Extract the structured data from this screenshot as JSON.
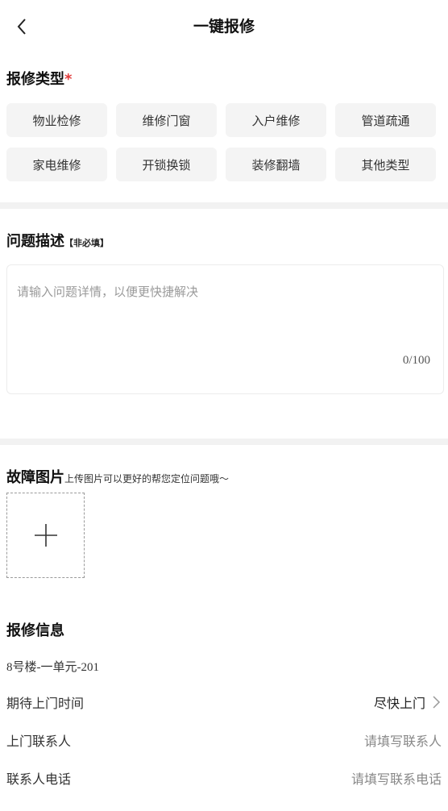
{
  "header": {
    "title": "一键报修",
    "back_icon": "chevron-left-icon"
  },
  "repair_type": {
    "title": "报修类型",
    "required_mark": "*",
    "options": [
      "物业检修",
      "维修门窗",
      "入户维修",
      "管道疏通",
      "家电维修",
      "开锁换锁",
      "装修翻墙",
      "其他类型"
    ]
  },
  "description": {
    "title": "问题描述",
    "optional_note": "【非必填】",
    "placeholder": "请输入问题详情，以便更快捷解决",
    "counter": "0/100"
  },
  "fault_images": {
    "title": "故障图片",
    "hint": "上传图片可以更好的帮您定位问题哦～",
    "add_icon": "plus-icon"
  },
  "repair_info": {
    "title": "报修信息",
    "address": "8号楼-一单元-201",
    "rows": [
      {
        "label": "期待上门时间",
        "value": "尽快上门",
        "chevron": "chevron-right-icon"
      },
      {
        "label": "上门联系人",
        "value": "请填写联系人"
      },
      {
        "label": "联系人电话",
        "value": "请填写联系电话"
      }
    ]
  },
  "colors": {
    "required": "#e23b3b",
    "chip_bg": "#f4f4f4",
    "divider": "#f2f2f2"
  }
}
